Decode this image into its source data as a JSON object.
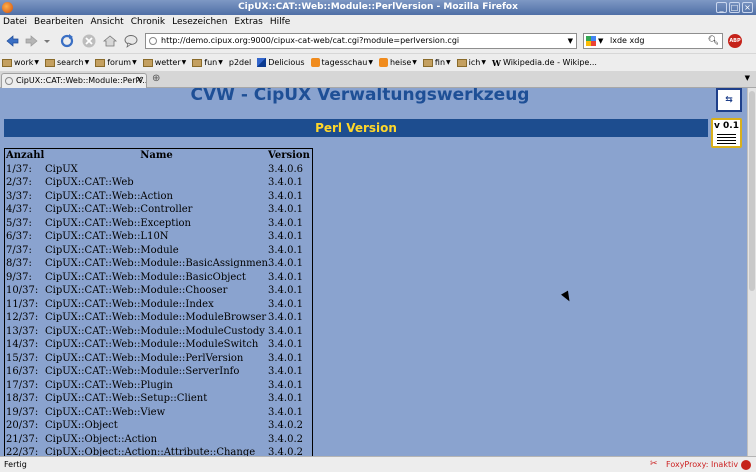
{
  "window": {
    "title": "CipUX::CAT::Web::Module::PerlVersion - Mozilla Firefox"
  },
  "menu": [
    "Datei",
    "Bearbeiten",
    "Ansicht",
    "Chronik",
    "Lesezeichen",
    "Extras",
    "Hilfe"
  ],
  "nav": {
    "url": "http://demo.cipux.org:9000/cipux-cat-web/cat.cgi?module=perlversion.cgi",
    "search_value": "lxde xdg",
    "abp_label": "ABP"
  },
  "bookmarks": [
    "work",
    "search",
    "forum",
    "wetter",
    "fun",
    "p2del",
    "Delicious",
    "tagesschau",
    "heise",
    "fin",
    "ich",
    "Wikipedia.de - Wikipe..."
  ],
  "tab": {
    "label": "CipUX::CAT::Web::Module::PerlV..."
  },
  "page": {
    "app_title": "CVW - CipUX Verwaltungswerkzeug",
    "section_title": "Perl Version",
    "version_badge": "v 0.1",
    "table": {
      "headers": [
        "Anzahl",
        "Name",
        "Version"
      ],
      "rows": [
        [
          "1/37:",
          "CipUX",
          "3.4.0.6"
        ],
        [
          "2/37:",
          "CipUX::CAT::Web",
          "3.4.0.1"
        ],
        [
          "3/37:",
          "CipUX::CAT::Web::Action",
          "3.4.0.1"
        ],
        [
          "4/37:",
          "CipUX::CAT::Web::Controller",
          "3.4.0.1"
        ],
        [
          "5/37:",
          "CipUX::CAT::Web::Exception",
          "3.4.0.1"
        ],
        [
          "6/37:",
          "CipUX::CAT::Web::L10N",
          "3.4.0.1"
        ],
        [
          "7/37:",
          "CipUX::CAT::Web::Module",
          "3.4.0.1"
        ],
        [
          "8/37:",
          "CipUX::CAT::Web::Module::BasicAssignment",
          "3.4.0.1"
        ],
        [
          "9/37:",
          "CipUX::CAT::Web::Module::BasicObject",
          "3.4.0.1"
        ],
        [
          "10/37:",
          "CipUX::CAT::Web::Module::Chooser",
          "3.4.0.1"
        ],
        [
          "11/37:",
          "CipUX::CAT::Web::Module::Index",
          "3.4.0.1"
        ],
        [
          "12/37:",
          "CipUX::CAT::Web::Module::ModuleBrowser",
          "3.4.0.1"
        ],
        [
          "13/37:",
          "CipUX::CAT::Web::Module::ModuleCustody",
          "3.4.0.1"
        ],
        [
          "14/37:",
          "CipUX::CAT::Web::Module::ModuleSwitch",
          "3.4.0.1"
        ],
        [
          "15/37:",
          "CipUX::CAT::Web::Module::PerlVersion",
          "3.4.0.1"
        ],
        [
          "16/37:",
          "CipUX::CAT::Web::Module::ServerInfo",
          "3.4.0.1"
        ],
        [
          "17/37:",
          "CipUX::CAT::Web::Plugin",
          "3.4.0.1"
        ],
        [
          "18/37:",
          "CipUX::CAT::Web::Setup::Client",
          "3.4.0.1"
        ],
        [
          "19/37:",
          "CipUX::CAT::Web::View",
          "3.4.0.1"
        ],
        [
          "20/37:",
          "CipUX::Object",
          "3.4.0.2"
        ],
        [
          "21/37:",
          "CipUX::Object::Action",
          "3.4.0.2"
        ],
        [
          "22/37:",
          "CipUX::Object::Action::Attribute::Change",
          "3.4.0.2"
        ]
      ]
    }
  },
  "status": {
    "left": "Fertig",
    "right": "FoxyProxy: Inaktiv"
  }
}
